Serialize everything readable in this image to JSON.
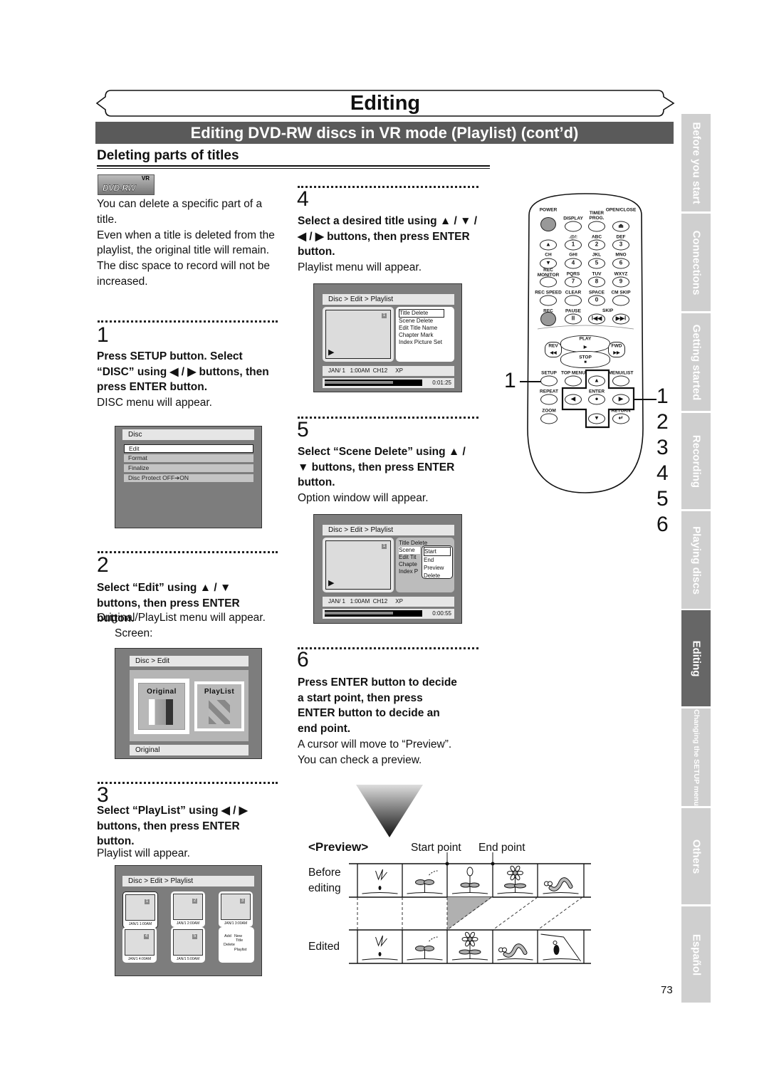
{
  "header": {
    "section_title": "Editing",
    "banner": "Editing DVD-RW discs in VR mode (Playlist) (cont’d)",
    "subtitle": "Deleting parts of titles",
    "disc_logo": "VR DVD-RW"
  },
  "intro": [
    "You can delete a specific part of a title.",
    "Even when a title is deleted from the playlist, the original title will remain.",
    "The disc space to record will not be increased."
  ],
  "steps": [
    {
      "num": "1",
      "instruction": "Press SETUP button. Select “DISC” using ◀ / ▶ buttons, then press ENTER button.",
      "result": "DISC menu will appear."
    },
    {
      "num": "2",
      "instruction": "Select “Edit” using ▲ / ▼ buttons, then press ENTER button.",
      "result": "Original/PlayList menu will appear.",
      "result2": "Screen:"
    },
    {
      "num": "3",
      "instruction": "Select “PlayList” using ◀ / ▶ buttons, then press ENTER button.",
      "result": "Playlist will appear."
    },
    {
      "num": "4",
      "instruction": "Select a desired title using ▲ / ▼ / ◀ / ▶ buttons, then press ENTER button.",
      "result": "Playlist menu will appear."
    },
    {
      "num": "5",
      "instruction": "Select “Scene Delete” using ▲ / ▼ buttons, then press ENTER button.",
      "result": "Option window will appear."
    },
    {
      "num": "6",
      "instruction": "Press ENTER button to decide a start point, then press ENTER button to decide an end point.",
      "result": "A cursor will move to “Preview”.",
      "result2": "You can check a preview."
    }
  ],
  "screen_disc": {
    "title": "Disc",
    "items": [
      "Edit",
      "Format",
      "Finalize",
      "Disc Protect OFF➔ON"
    ],
    "selected": "Edit"
  },
  "screen_edit": {
    "title": "Disc > Edit",
    "options": [
      "Original",
      "PlayList"
    ],
    "status": "Original"
  },
  "screen_playlist": {
    "title": "Disc > Edit > Playlist",
    "thumbs": [
      {
        "num": "1",
        "date": "JAN/1   1:00AM"
      },
      {
        "num": "2",
        "date": "JAN/1   2:00AM"
      },
      {
        "num": "3",
        "date": "JAN/1   3:00AM"
      },
      {
        "num": "4",
        "date": "JAN/1   4:00AM"
      },
      {
        "num": "5",
        "date": "JAN/1   5:00AM"
      }
    ],
    "options": [
      "Add",
      "New",
      "Title",
      "Delete",
      "Playlist"
    ]
  },
  "screen_menu": {
    "title": "Disc > Edit > Playlist",
    "thumb_num": "1",
    "items": [
      "Title Delete",
      "Scene Delete",
      "Edit Title Name",
      "Chapter Mark",
      "Index Picture Set"
    ],
    "info": "JAN/ 1   1:00AM  CH12     XP",
    "time": "0:01:25",
    "progress": 0.7
  },
  "screen_option": {
    "title": "Disc > Edit > Playlist",
    "thumb_num": "1",
    "items": [
      "Title Delete",
      "Scene",
      "Edit Tit",
      "Chapte",
      "Index P"
    ],
    "popup": [
      "Start",
      "End",
      "Preview",
      "Delete"
    ],
    "info": "JAN/ 1   1:00AM  CH12     XP",
    "time": "0:00:55",
    "progress": 0.7
  },
  "preview": {
    "label": "<Preview>",
    "start_point": "Start point",
    "end_point": "End point",
    "before_label_1": "Before",
    "before_label_2": "editing",
    "edited_label": "Edited"
  },
  "remote": {
    "buttons": [
      {
        "label": "POWER",
        "key": ""
      },
      {
        "label": "DISPLAY",
        "key": ""
      },
      {
        "label": "TIMER\nPROG.",
        "key": ""
      },
      {
        "label": "OPEN/CLOSE",
        "key": "⏏"
      },
      {
        "label": "",
        "key": "▲"
      },
      {
        "label": ".@/:",
        "key": "1"
      },
      {
        "label": "ABC",
        "key": "2"
      },
      {
        "label": "DEF",
        "key": "3"
      },
      {
        "label": "CH",
        "key": "▼"
      },
      {
        "label": "GHI",
        "key": "4"
      },
      {
        "label": "JKL",
        "key": "5"
      },
      {
        "label": "MNO",
        "key": "6"
      },
      {
        "label": "REC\nMONITOR",
        "key": ""
      },
      {
        "label": "PQRS",
        "key": "7"
      },
      {
        "label": "TUV",
        "key": "8"
      },
      {
        "label": "WXYZ",
        "key": "9"
      },
      {
        "label": "REC SPEED",
        "key": ""
      },
      {
        "label": "CLEAR",
        "key": ""
      },
      {
        "label": "SPACE",
        "key": "0"
      },
      {
        "label": "CM SKIP",
        "key": ""
      },
      {
        "label": "REC",
        "key": ""
      },
      {
        "label": "PAUSE",
        "key": "II"
      },
      {
        "label": "",
        "key": "I◀◀"
      },
      {
        "label": "",
        "key": "▶▶I"
      },
      {
        "label": "REV",
        "key": "◀◀"
      },
      {
        "label": "PLAY",
        "key": "▶"
      },
      {
        "label": "FWD",
        "key": "▶▶"
      },
      {
        "label": "STOP",
        "key": "■"
      },
      {
        "label": "SETUP",
        "key": ""
      },
      {
        "label": "TOP MENU",
        "key": ""
      },
      {
        "label": "",
        "key": "▲"
      },
      {
        "label": "MENU/LIST",
        "key": ""
      },
      {
        "label": "REPEAT",
        "key": ""
      },
      {
        "label": "",
        "key": "◀"
      },
      {
        "label": "ENTER",
        "key": "●"
      },
      {
        "label": "",
        "key": "▶"
      },
      {
        "label": "ZOOM",
        "key": ""
      },
      {
        "label": "",
        "key": "▼"
      },
      {
        "label": "RETURN",
        "key": "↵"
      }
    ],
    "skip_label": "SKIP",
    "callout_left": "1",
    "callout_right": [
      "1",
      "2",
      "3",
      "4",
      "5",
      "6"
    ]
  },
  "side_tabs": [
    {
      "label": "Before you start",
      "active": false
    },
    {
      "label": "Connections",
      "active": false
    },
    {
      "label": "Getting started",
      "active": false
    },
    {
      "label": "Recording",
      "active": false
    },
    {
      "label": "Playing discs",
      "active": false
    },
    {
      "label": "Editing",
      "active": true
    },
    {
      "label": "Changing the SETUP menu",
      "active": false
    },
    {
      "label": "Others",
      "active": false
    },
    {
      "label": "Español",
      "active": false
    }
  ],
  "page_number": "73",
  "colors": {
    "banner": "#5a5a5a",
    "screen": "#7d7d7d",
    "tab": "#cfcfcf",
    "tab_active": "#666666"
  }
}
